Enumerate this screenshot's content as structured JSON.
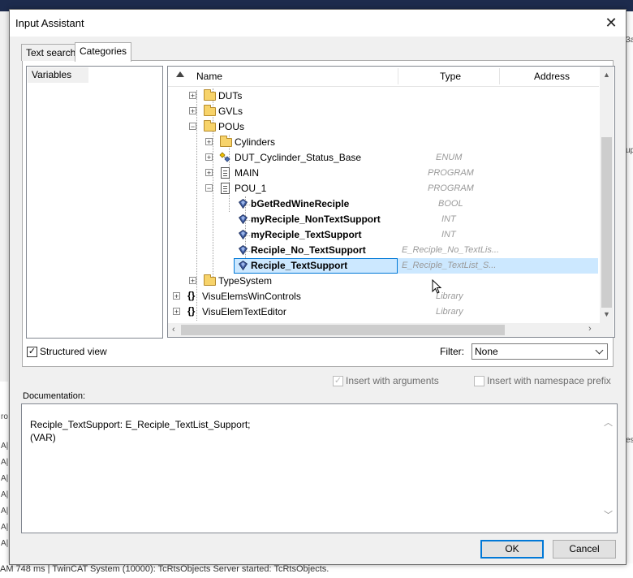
{
  "dialog": {
    "title": "Input Assistant",
    "close_glyph": "✕",
    "tabs": [
      {
        "label": "Text search",
        "selected": false
      },
      {
        "label": "Categories",
        "selected": true
      }
    ],
    "categories": [
      "Variables"
    ],
    "tree": {
      "columns": [
        "Name",
        "Type",
        "Address"
      ],
      "rows": [
        {
          "name": "DUTs",
          "type": "",
          "icon": "folder-icon",
          "expander": "+",
          "bold": false
        },
        {
          "name": "GVLs",
          "type": "",
          "icon": "folder-icon",
          "expander": "+",
          "bold": false
        },
        {
          "name": "POUs",
          "type": "",
          "icon": "folder-icon",
          "expander": "−",
          "bold": false
        },
        {
          "name": "Cylinders",
          "type": "",
          "icon": "folder-icon",
          "expander": "+",
          "bold": false
        },
        {
          "name": "DUT_Cyclinder_Status_Base",
          "type": "ENUM",
          "icon": "enum-icon",
          "expander": "+",
          "bold": false
        },
        {
          "name": "MAIN",
          "type": "PROGRAM",
          "icon": "program-icon",
          "expander": "+",
          "bold": false
        },
        {
          "name": "POU_1",
          "type": "PROGRAM",
          "icon": "program-icon",
          "expander": "−",
          "bold": false
        },
        {
          "name": "bGetRedWineReciple",
          "type": "BOOL",
          "icon": "variable-icon",
          "expander": "",
          "bold": true
        },
        {
          "name": "myReciple_NonTextSupport",
          "type": "INT",
          "icon": "variable-icon",
          "expander": "",
          "bold": true
        },
        {
          "name": "myReciple_TextSupport",
          "type": "INT",
          "icon": "variable-icon",
          "expander": "",
          "bold": true
        },
        {
          "name": "Reciple_No_TextSupport",
          "type": "E_Reciple_No_TextLis...",
          "icon": "variable-icon",
          "expander": "",
          "bold": true
        },
        {
          "name": "Reciple_TextSupport",
          "type": "E_Reciple_TextList_S...",
          "icon": "variable-icon",
          "expander": "",
          "bold": true
        },
        {
          "name": "TypeSystem",
          "type": "",
          "icon": "folder-icon",
          "expander": "+",
          "bold": false
        },
        {
          "name": "VisuElemsWinControls",
          "type": "Library",
          "icon": "library-icon",
          "expander": "+",
          "bold": false
        },
        {
          "name": "VisuElemTextEditor",
          "type": "Library",
          "icon": "library-icon",
          "expander": "+",
          "bold": false
        }
      ],
      "selected_row": "Reciple_TextSupport"
    },
    "structured_view": {
      "label": "Structured view",
      "checked": true
    },
    "filter": {
      "label": "Filter:",
      "value": "None"
    },
    "insert_with_arguments": {
      "label": "Insert with arguments",
      "checked": true,
      "enabled": false
    },
    "insert_with_namespace": {
      "label": "Insert with namespace prefix",
      "checked": false,
      "enabled": false
    },
    "documentation": {
      "label": "Documentation:",
      "text": "Reciple_TextSupport: E_Reciple_TextList_Support;\n(VAR)"
    },
    "ok_label": "OK",
    "cancel_label": "Cancel"
  },
  "background": {
    "status_text": "AM 748 ms | TwinCAT System (10000): TcRtsObjects Server started: TcRtsObjects.",
    "left_fragments": [
      "ro",
      "A|",
      "A|",
      "A|",
      "A|",
      "A|",
      "A|",
      "A|"
    ],
    "right_fragments": [
      "3a",
      "up",
      "es"
    ]
  },
  "colors": {
    "selection_fill": "#cce8ff",
    "selection_border": "#0078d7",
    "type_text": "#9a9a9a",
    "title_bar_bg": "#1d2b4d"
  }
}
